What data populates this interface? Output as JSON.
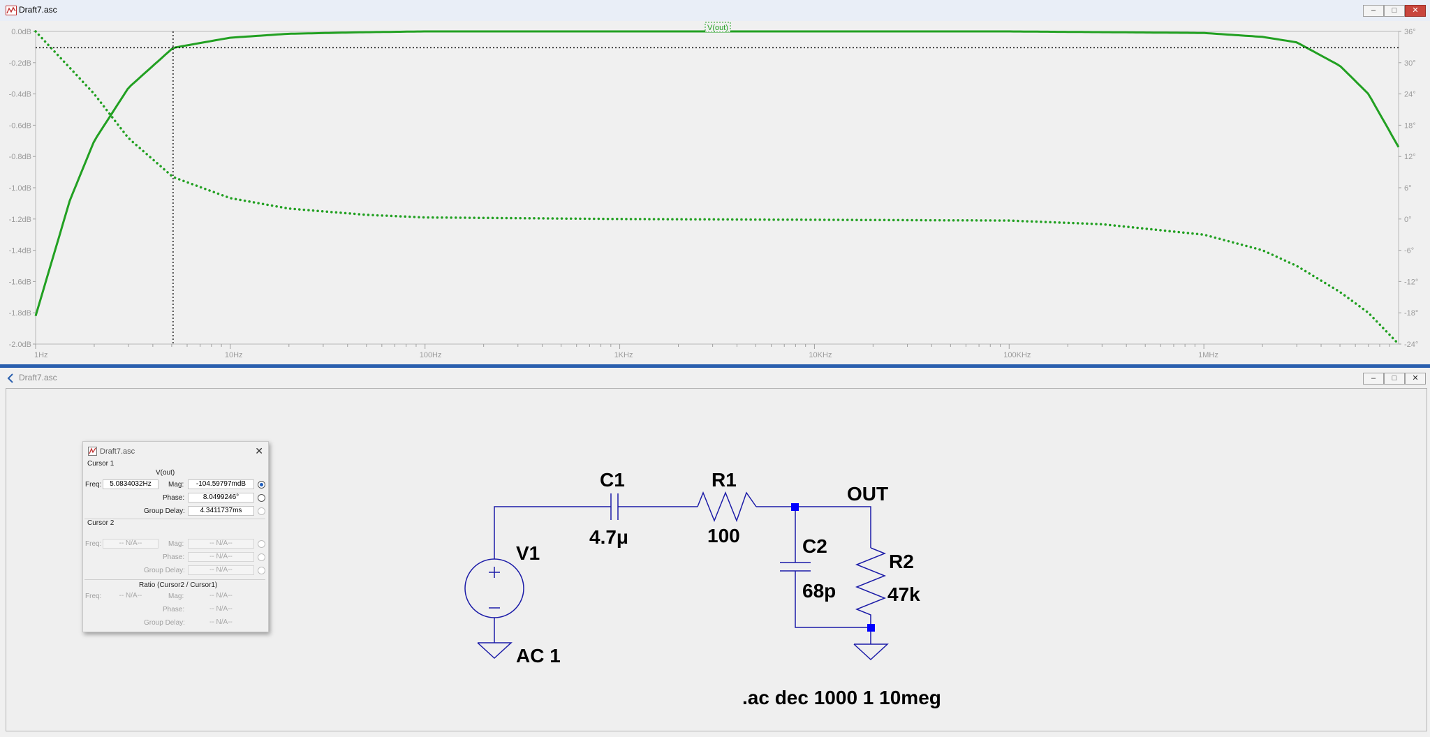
{
  "plot_window": {
    "title": "Draft7.asc",
    "trace_label": "V(out)",
    "buttons": {
      "minimize": "–",
      "maximize": "□",
      "close": "✕"
    },
    "colors": {
      "trace": "#22a022",
      "axis_text": "#9a9a9a",
      "cursor": "#000000"
    }
  },
  "chart_data": {
    "type": "line",
    "title": "V(out)",
    "x_scale": "log",
    "xlim": [
      1,
      10000000
    ],
    "x_ticks": [
      "1Hz",
      "10Hz",
      "100Hz",
      "1KHz",
      "10KHz",
      "100KHz",
      "1MHz"
    ],
    "y_left_ticks": [
      "0.0dB",
      "-0.2dB",
      "-0.4dB",
      "-0.6dB",
      "-0.8dB",
      "-1.0dB",
      "-1.2dB",
      "-1.4dB",
      "-1.6dB",
      "-1.8dB",
      "-2.0dB"
    ],
    "y_right_ticks": [
      "36°",
      "30°",
      "24°",
      "18°",
      "12°",
      "6°",
      "0°",
      "-6°",
      "-12°",
      "-18°",
      "-24°"
    ],
    "ylim_left": [
      -2.0,
      0.0
    ],
    "ylim_right": [
      -24,
      36
    ],
    "series": [
      {
        "name": "Magnitude",
        "style": "solid",
        "x": [
          1,
          1.5,
          2,
          3,
          5.08,
          10,
          20,
          50,
          100,
          1000,
          100000,
          1000000,
          2000000,
          3000000,
          5000000,
          7000000,
          10000000
        ],
        "y_db": [
          -1.82,
          -1.08,
          -0.7,
          -0.36,
          -0.105,
          -0.04,
          -0.015,
          -0.005,
          0.0,
          0.0,
          0.0,
          -0.01,
          -0.035,
          -0.07,
          -0.22,
          -0.4,
          -0.74
        ]
      },
      {
        "name": "Phase",
        "style": "dotted",
        "x": [
          1,
          1.5,
          2,
          3,
          5.08,
          10,
          20,
          50,
          100,
          1000,
          100000,
          300000,
          1000000,
          2000000,
          3000000,
          5000000,
          7000000,
          10000000
        ],
        "y_deg": [
          36,
          29,
          24,
          15.5,
          8.05,
          4,
          2,
          0.8,
          0.3,
          0,
          -0.3,
          -1,
          -3,
          -6,
          -9,
          -14,
          -18,
          -24
        ]
      }
    ],
    "cursor": {
      "x": 5.0834032,
      "y_db": -0.1046
    }
  },
  "schematic_window": {
    "title": "Draft7.asc",
    "buttons": {
      "minimize": "–",
      "maximize": "□",
      "close": "✕"
    },
    "components": {
      "c1_name": "C1",
      "c1_value": "4.7μ",
      "r1_name": "R1",
      "r1_value": "100",
      "c2_name": "C2",
      "c2_value": "68p",
      "r2_name": "R2",
      "r2_value": "47k",
      "v1_name": "V1",
      "v1_value": "AC 1",
      "net_label": "OUT",
      "directive": ".ac dec 1000 1 10meg"
    },
    "colors": {
      "wire": "#1c1ca8",
      "junction": "#0000ff",
      "text": "#000000"
    }
  },
  "cursor_dialog": {
    "title": "Draft7.asc",
    "close": "✕",
    "cursor1": {
      "header": "Cursor 1",
      "trace": "V(out)",
      "freq_label": "Freq:",
      "freq": "5.0834032Hz",
      "mag_label": "Mag:",
      "mag": "-104.59797mdB",
      "phase_label": "Phase:",
      "phase": "8.0499246°",
      "gd_label": "Group Delay:",
      "gd": "4.3411737ms"
    },
    "cursor2": {
      "header": "Cursor 2",
      "freq_label": "Freq:",
      "freq": "-- N/A--",
      "mag_label": "Mag:",
      "mag": "-- N/A--",
      "phase_label": "Phase:",
      "phase": "-- N/A--",
      "gd_label": "Group Delay:",
      "gd": "-- N/A--"
    },
    "ratio": {
      "header": "Ratio (Cursor2 / Cursor1)",
      "freq_label": "Freq:",
      "freq": "-- N/A--",
      "mag_label": "Mag:",
      "mag": "-- N/A--",
      "phase_label": "Phase:",
      "phase": "-- N/A--",
      "gd_label": "Group Delay:",
      "gd": "-- N/A--"
    }
  }
}
